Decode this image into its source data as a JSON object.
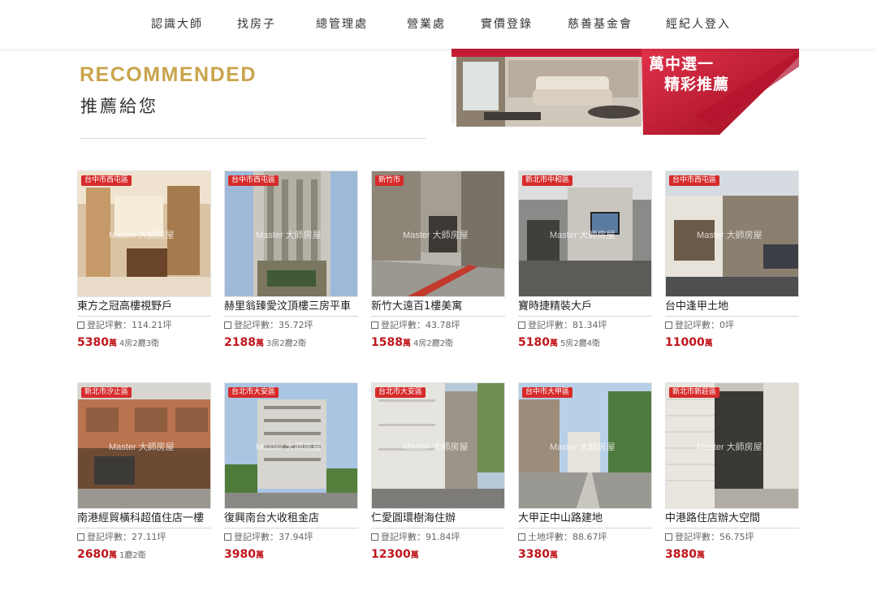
{
  "nav": {
    "items": [
      "認識大師",
      "找房子",
      "總管理處",
      "營業處",
      "實價登錄",
      "慈善基金會",
      "經紀人登入"
    ]
  },
  "section": {
    "title_en": "RECOMMENDED",
    "title_zh": "推薦給您"
  },
  "banner": {
    "line1": "萬中選一",
    "line2": "精彩推薦"
  },
  "watermark": "Master 大師房屋",
  "colors": {
    "accent_gold": "#c9a44c",
    "price_red": "#c0161c",
    "tag_red": "#d62b2b"
  },
  "listings": [
    {
      "tag": "台中市西屯區",
      "title": "東方之冠高樓視野戶",
      "area_label": "登記坪數：",
      "area": "114.21坪",
      "price": "5380",
      "unit": "萬",
      "rooms": "4房2廳3衛"
    },
    {
      "tag": "台中市西屯區",
      "title": "赫里翁臻愛汶頂樓三房平車",
      "area_label": "登記坪數：",
      "area": "35.72坪",
      "price": "2188",
      "unit": "萬",
      "rooms": "3房2廳2衛"
    },
    {
      "tag": "新竹市",
      "title": "新竹大遠百1樓美寓",
      "area_label": "登記坪數：",
      "area": "43.78坪",
      "price": "1588",
      "unit": "萬",
      "rooms": "4房2廳2衛"
    },
    {
      "tag": "新北市中和區",
      "title": "寶時捷精裝大戶",
      "area_label": "登記坪數：",
      "area": "81.34坪",
      "price": "5180",
      "unit": "萬",
      "rooms": "5房2廳4衛"
    },
    {
      "tag": "台中市西屯區",
      "title": "台中逢甲土地",
      "area_label": "登記坪數：",
      "area": "0坪",
      "price": "11000",
      "unit": "萬",
      "rooms": ""
    },
    {
      "tag": "新北市汐止區",
      "title": "南港經貿橫科超值住店一樓",
      "area_label": "登記坪數：",
      "area": "27.11坪",
      "price": "2680",
      "unit": "萬",
      "rooms": "1廳2衛"
    },
    {
      "tag": "台北市大安區",
      "title": "復興南台大收租金店",
      "area_label": "登記坪數：",
      "area": "37.94坪",
      "price": "3980",
      "unit": "萬",
      "rooms": ""
    },
    {
      "tag": "台北市大安區",
      "title": "仁愛圓環樹海住辦",
      "area_label": "登記坪數：",
      "area": "91.84坪",
      "price": "12300",
      "unit": "萬",
      "rooms": ""
    },
    {
      "tag": "台中市大甲區",
      "title": "大甲正中山路建地",
      "area_label": "土地坪數：",
      "area": "88.67坪",
      "price": "3380",
      "unit": "萬",
      "rooms": ""
    },
    {
      "tag": "新北市新莊區",
      "title": "中港路住店辦大空間",
      "area_label": "登記坪數：",
      "area": "56.75坪",
      "price": "3880",
      "unit": "萬",
      "rooms": ""
    }
  ]
}
